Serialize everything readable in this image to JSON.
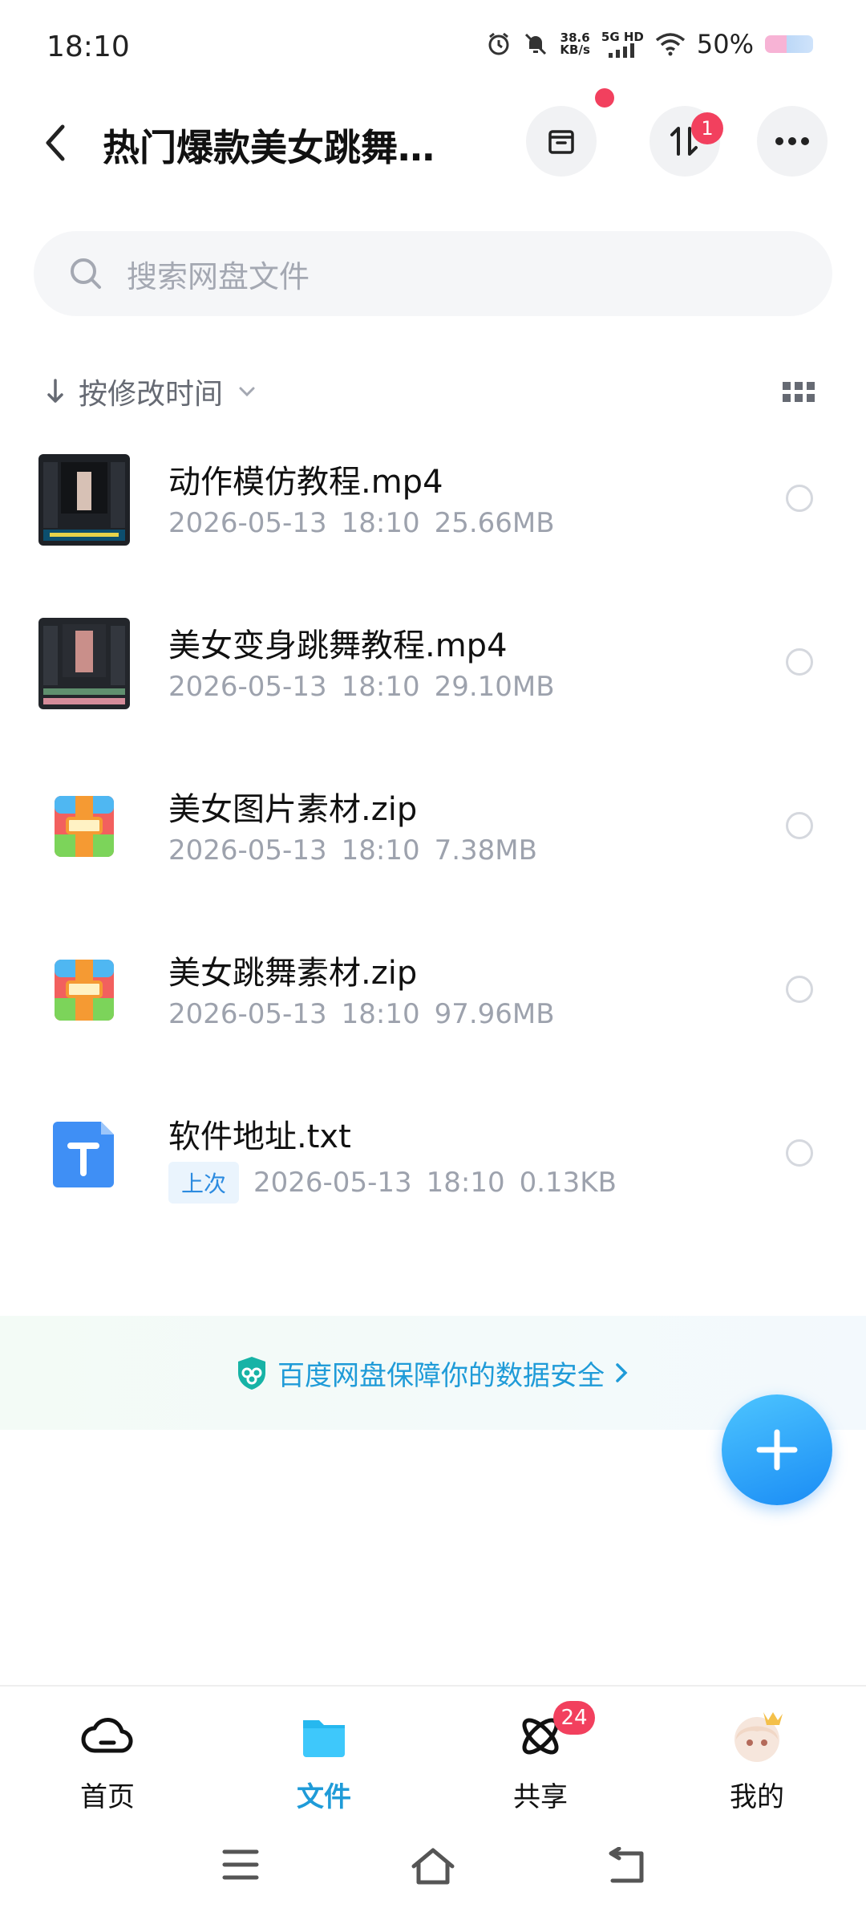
{
  "status_bar": {
    "time": "18:10",
    "net_speed_value": "38.6",
    "net_speed_unit": "KB/s",
    "network": "5G HD",
    "battery": "50%"
  },
  "header": {
    "title": "热门爆款美女跳舞…",
    "transfer_badge": "1"
  },
  "search": {
    "placeholder": "搜索网盘文件"
  },
  "sort": {
    "label": "按修改时间"
  },
  "files": [
    {
      "name": "动作模仿教程.mp4",
      "date": "2026-05-13",
      "time": "18:10",
      "size": "25.66MB",
      "type": "video"
    },
    {
      "name": "美女变身跳舞教程.mp4",
      "date": "2026-05-13",
      "time": "18:10",
      "size": "29.10MB",
      "type": "video"
    },
    {
      "name": "美女图片素材.zip",
      "date": "2026-05-13",
      "time": "18:10",
      "size": "7.38MB",
      "type": "zip"
    },
    {
      "name": "美女跳舞素材.zip",
      "date": "2026-05-13",
      "time": "18:10",
      "size": "97.96MB",
      "type": "zip"
    },
    {
      "name": "软件地址.txt",
      "tag": "上次",
      "date": "2026-05-13",
      "time": "18:10",
      "size": "0.13KB",
      "type": "txt"
    }
  ],
  "banner": {
    "text": "百度网盘保障你的数据安全"
  },
  "bottom_nav": {
    "tabs": [
      {
        "label": "首页",
        "icon": "cloud-icon"
      },
      {
        "label": "文件",
        "icon": "folder-icon",
        "active": true
      },
      {
        "label": "共享",
        "icon": "share-orbit-icon",
        "badge": "24"
      },
      {
        "label": "我的",
        "icon": "avatar-icon"
      }
    ]
  },
  "colors": {
    "accent": "#1f9bd8",
    "badge": "#f2405e",
    "fab": "#1a8cf5"
  }
}
